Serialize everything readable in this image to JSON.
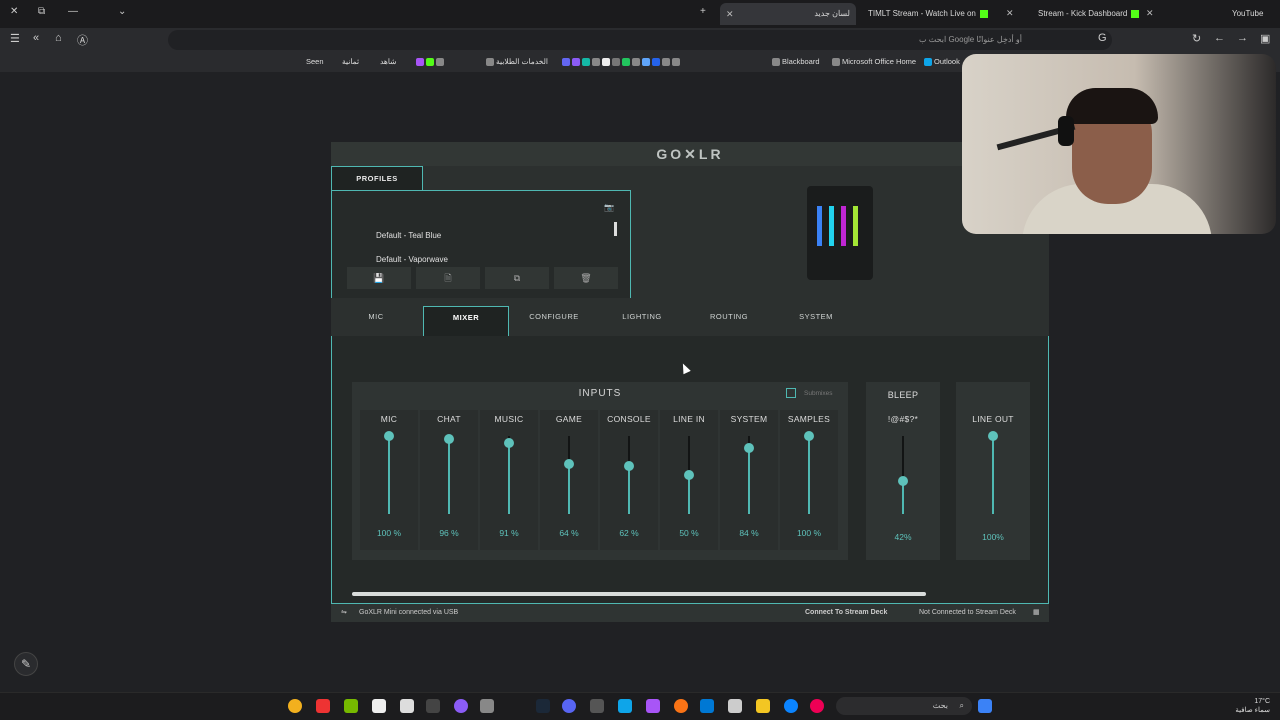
{
  "browser": {
    "tabs": [
      {
        "label": "لسان جديد",
        "active": true
      },
      {
        "label": "TIMLT Stream - Watch Live on"
      },
      {
        "label": "Stream - Kick Dashboard"
      },
      {
        "label": "YouTube"
      }
    ],
    "omnibox_placeholder": "ابحث ب Google أو أدخِل عنوانًا",
    "bookmarks": [
      "Seen",
      "ثمانية",
      "شاهد",
      "الخدمات الطلابية",
      "Blackboard",
      "Microsoft Office Home",
      "Outlook"
    ]
  },
  "app": {
    "logo": "GO✕LR",
    "profiles": {
      "tab_label": "PROFILES",
      "items": [
        "Default - Teal Blue",
        "Default - Vaporwave"
      ],
      "buttons": [
        "💾",
        "🗎",
        "⧉",
        "🗑"
      ]
    },
    "nav_tabs": [
      "MIC",
      "MIXER",
      "CONFIGURE",
      "LIGHTING",
      "ROUTING",
      "SYSTEM"
    ],
    "active_tab": "MIXER",
    "inputs": {
      "title": "INPUTS",
      "submixes_label": "Submixes",
      "channels": [
        {
          "name": "MIC",
          "percent": "100 %",
          "level": 1.0
        },
        {
          "name": "CHAT",
          "percent": "96 %",
          "level": 0.96
        },
        {
          "name": "MUSIC",
          "percent": "91 %",
          "level": 0.91
        },
        {
          "name": "GAME",
          "percent": "64 %",
          "level": 0.64
        },
        {
          "name": "CONSOLE",
          "percent": "62 %",
          "level": 0.62
        },
        {
          "name": "LINE IN",
          "percent": "50 %",
          "level": 0.5
        },
        {
          "name": "SYSTEM",
          "percent": "84 %",
          "level": 0.84
        },
        {
          "name": "SAMPLES",
          "percent": "100 %",
          "level": 1.0
        }
      ]
    },
    "bleep": {
      "title": "BLEEP",
      "name": "!@#$?*",
      "percent": "42%",
      "level": 0.42
    },
    "line_out": {
      "title": "LINE OUT",
      "percent": "100%",
      "level": 1.0
    },
    "status": {
      "left": "GoXLR Mini connected via USB",
      "connect": "Connect To Stream Deck",
      "right": "Not Connected to Stream Deck"
    }
  },
  "taskbar": {
    "search": "بحث",
    "weather_temp": "17°C",
    "weather_desc": "سماء صافية"
  },
  "colors": {
    "accent": "#4fb8b2",
    "knob": "#5ec2bb",
    "kick": "#53fc18"
  }
}
